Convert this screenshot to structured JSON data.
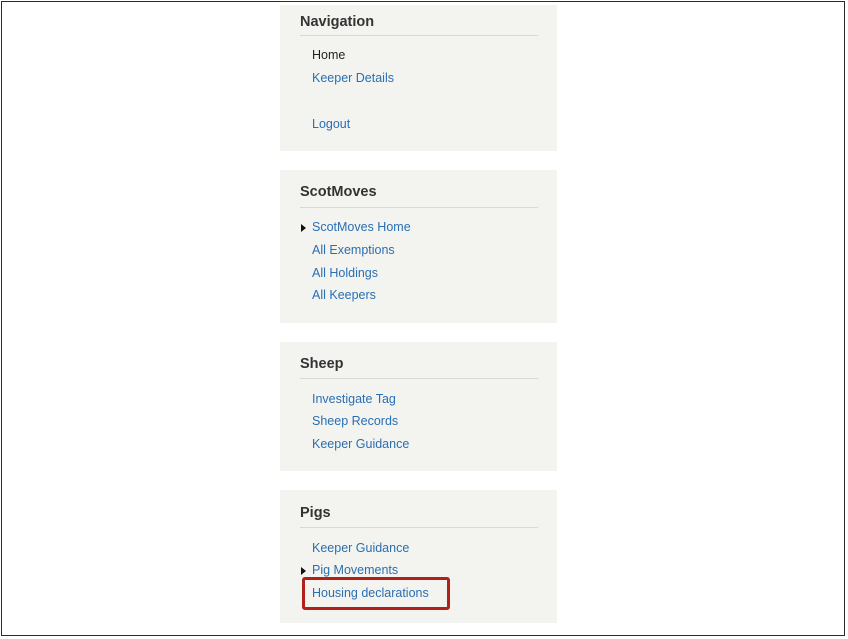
{
  "navigation": {
    "title": "Navigation",
    "items": [
      {
        "label": "Home",
        "active": true
      },
      {
        "label": "Keeper Details"
      },
      {
        "label": "Logout"
      }
    ]
  },
  "scotmoves": {
    "title": "ScotMoves",
    "items": [
      {
        "label": "ScotMoves Home",
        "expandable": true
      },
      {
        "label": "All Exemptions"
      },
      {
        "label": "All Holdings"
      },
      {
        "label": "All Keepers"
      }
    ]
  },
  "sheep": {
    "title": "Sheep",
    "items": [
      {
        "label": "Investigate Tag"
      },
      {
        "label": "Sheep Records"
      },
      {
        "label": "Keeper Guidance"
      }
    ]
  },
  "pigs": {
    "title": "Pigs",
    "items": [
      {
        "label": "Keeper Guidance"
      },
      {
        "label": "Pig Movements",
        "expandable": true
      },
      {
        "label": "Housing declarations",
        "highlighted": true
      }
    ]
  },
  "colors": {
    "link": "#2a6fb3",
    "panel_bg": "#f3f3f0",
    "highlight": "#b22118"
  },
  "icons": {
    "expand": "caret-right-icon"
  }
}
